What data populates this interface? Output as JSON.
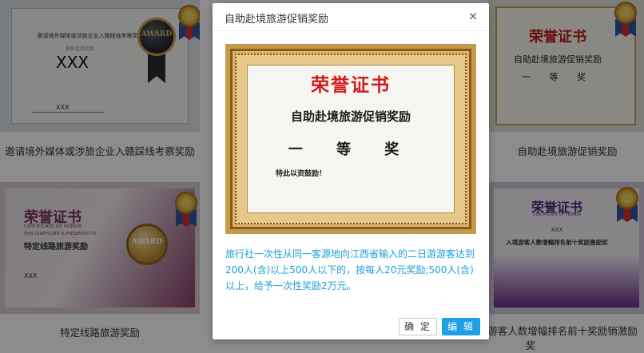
{
  "cards": [
    {
      "caption": "邀请境外媒体或涉旅企业入赣踩线考察奖励",
      "cert_line": "邀请境外媒体或涉旅企业入赣踩线考察奖励",
      "cert_sub": "表彰此项奖励",
      "name": "XXX",
      "bottom": "XXX",
      "award_text": "AWARD"
    },
    {
      "caption": "自助赴境旅游促销奖励",
      "title": "荣誉证书",
      "name": "自助赴境旅游促销奖励",
      "level": "一 等 奖"
    },
    {
      "caption": "特定线路旅游奖励",
      "title": "荣誉证书",
      "sub1": "CERTIFICATE OF HONOR",
      "sub2": "THIS CERTIFICATE IS PRESENTED TO",
      "name": "特定线路旅游奖励",
      "bottom": "XXX",
      "award_text": "AWARD"
    },
    {
      "caption_line1": "游客人数增幅排名前十奖励销激励",
      "caption_line2": "奖",
      "title": "荣誉证书",
      "sub": "CERTIFICATE OF HONOR",
      "xxx": "XXX",
      "name": "入境游客人数增幅排名前十奖励激励奖"
    }
  ],
  "dialog": {
    "title": "自助赴境旅游促销奖励",
    "close": "×",
    "certificate": {
      "title": "荣誉证书",
      "award_name": "自助赴境旅游促销奖励",
      "level": "一 等 奖",
      "note": "特此以资鼓励！"
    },
    "description": "旅行社一次性从同一客源地向江西省输入的二日游游客达到200人(含)以上500人以下的，按每人20元奖励;500人(含)以上，给予一次性奖励2万元。",
    "ok_label": "确 定",
    "edit_label": "编 辑"
  },
  "colors": {
    "accent": "#1e9fe8",
    "desc_text": "#1e9fd8",
    "cert_red": "#d31a1a"
  }
}
